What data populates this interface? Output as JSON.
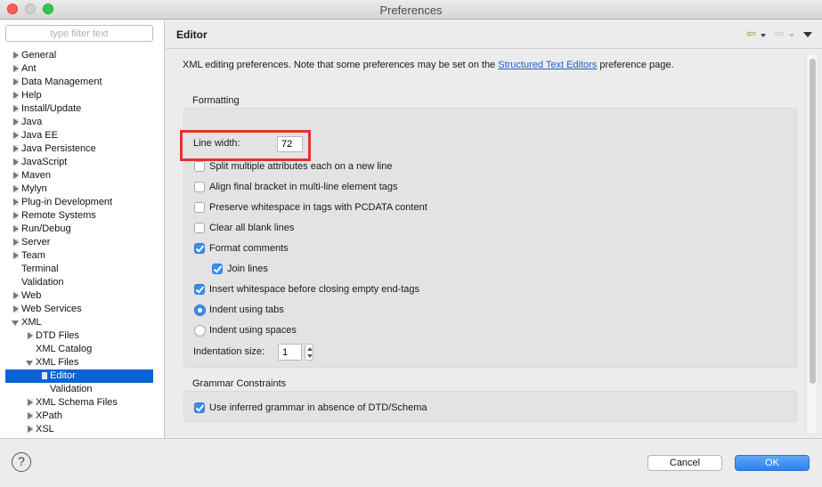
{
  "window": {
    "title": "Preferences"
  },
  "sidebar": {
    "filter_placeholder": "type filter text",
    "items": [
      {
        "label": "General"
      },
      {
        "label": "Ant"
      },
      {
        "label": "Data Management"
      },
      {
        "label": "Help"
      },
      {
        "label": "Install/Update"
      },
      {
        "label": "Java"
      },
      {
        "label": "Java EE"
      },
      {
        "label": "Java Persistence"
      },
      {
        "label": "JavaScript"
      },
      {
        "label": "Maven"
      },
      {
        "label": "Mylyn"
      },
      {
        "label": "Plug-in Development"
      },
      {
        "label": "Remote Systems"
      },
      {
        "label": "Run/Debug"
      },
      {
        "label": "Server"
      },
      {
        "label": "Team"
      },
      {
        "label": "Terminal"
      },
      {
        "label": "Validation"
      },
      {
        "label": "Web"
      },
      {
        "label": "Web Services"
      },
      {
        "label": "XML"
      },
      {
        "label": "DTD Files"
      },
      {
        "label": "XML Catalog"
      },
      {
        "label": "XML Files"
      },
      {
        "label": "Editor"
      },
      {
        "label": "Validation"
      },
      {
        "label": "XML Schema Files"
      },
      {
        "label": "XPath"
      },
      {
        "label": "XSL"
      }
    ],
    "selected": "Editor"
  },
  "page": {
    "title": "Editor",
    "description_prefix": "XML editing preferences.  Note that some preferences may be set on the ",
    "description_link": "Structured Text Editors",
    "description_suffix": " preference page.",
    "nav_back_icon": "back-arrow-icon",
    "nav_forward_icon": "forward-arrow-icon",
    "menu_icon": "view-menu-icon"
  },
  "formatting": {
    "label": "Formatting",
    "line_width_label": "Line width:",
    "line_width_value": "72",
    "split_attributes": {
      "label": "Split multiple attributes each on a new line",
      "checked": false
    },
    "align_bracket": {
      "label": "Align final bracket in multi-line element tags",
      "checked": false
    },
    "preserve_whitespace": {
      "label": "Preserve whitespace in tags with PCDATA content",
      "checked": false
    },
    "clear_blank": {
      "label": "Clear all blank lines",
      "checked": false
    },
    "format_comments": {
      "label": "Format comments",
      "checked": true
    },
    "join_lines": {
      "label": "Join lines",
      "checked": true
    },
    "insert_whitespace": {
      "label": "Insert whitespace before closing empty end-tags",
      "checked": true
    },
    "indent_tabs": {
      "label": "Indent using tabs",
      "selected": true
    },
    "indent_spaces": {
      "label": "Indent using spaces",
      "selected": false
    },
    "indentation_size_label": "Indentation size:",
    "indentation_size_value": "1"
  },
  "grammar": {
    "label": "Grammar Constraints",
    "use_inferred": {
      "label": "Use inferred grammar in absence of DTD/Schema",
      "checked": true
    }
  },
  "buttons": {
    "help": "?",
    "cancel": "Cancel",
    "ok": "OK"
  },
  "colors": {
    "accent": "#3a8ef2",
    "selection": "#0b63d1",
    "highlight_box": "#e8302c",
    "link": "#1f5fcc"
  }
}
